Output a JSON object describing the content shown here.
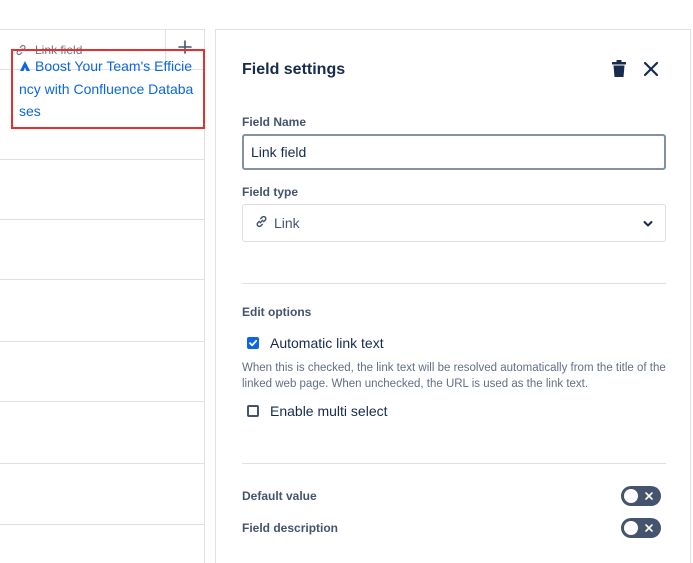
{
  "table": {
    "column_header": "Link field",
    "add_column_icon": "plus-icon",
    "link_cell": {
      "icon": "confluence-icon",
      "text": "Boost Your Team's Efficiency with Confluence Databases"
    }
  },
  "panel": {
    "title": "Field settings",
    "delete_icon": "trash-icon",
    "close_icon": "close-icon",
    "field_name_label": "Field Name",
    "field_name_value": "Link field",
    "field_type_label": "Field type",
    "field_type_icon": "link-icon",
    "field_type_value": "Link",
    "edit_options_label": "Edit options",
    "automatic_link_text_label": "Automatic link text",
    "automatic_link_text_checked": true,
    "automatic_link_text_helper": "When this is checked, the link text will be resolved automatically from the title of the linked web page. When unchecked, the URL is used as the link text.",
    "enable_multi_select_label": "Enable multi select",
    "enable_multi_select_checked": false,
    "default_value_label": "Default value",
    "default_value_enabled": false,
    "field_description_label": "Field description",
    "field_description_enabled": false
  },
  "colors": {
    "link": "#0c66e4",
    "highlight_border": "#e5312d",
    "toggle_off": "#44546f",
    "checkbox_checked": "#0c66e4"
  }
}
